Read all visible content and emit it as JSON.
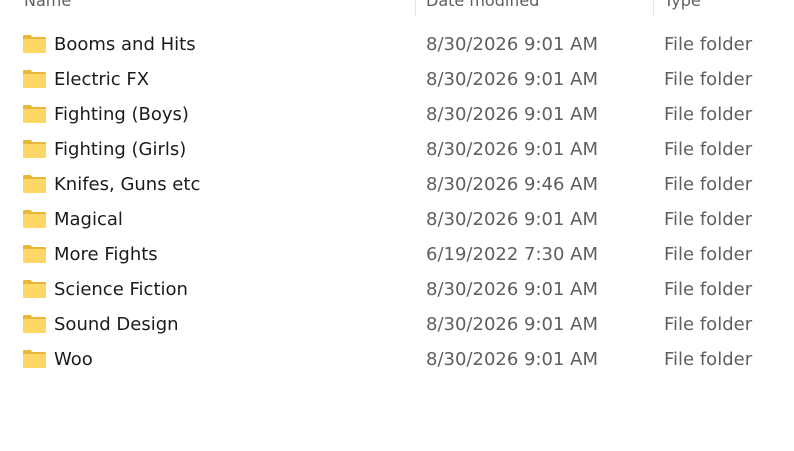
{
  "header": {
    "name_label": "Name",
    "date_label": "Date modified",
    "type_label": "Type"
  },
  "files": [
    {
      "name": "Booms and Hits",
      "date": "8/30/2026 9:01 AM",
      "type": "File folder",
      "icon": "folder-icon"
    },
    {
      "name": "Electric FX",
      "date": "8/30/2026 9:01 AM",
      "type": "File folder",
      "icon": "folder-icon"
    },
    {
      "name": "Fighting (Boys)",
      "date": "8/30/2026 9:01 AM",
      "type": "File folder",
      "icon": "folder-icon"
    },
    {
      "name": "Fighting (Girls)",
      "date": "8/30/2026 9:01 AM",
      "type": "File folder",
      "icon": "folder-icon"
    },
    {
      "name": "Knifes, Guns etc",
      "date": "8/30/2026 9:46 AM",
      "type": "File folder",
      "icon": "folder-icon"
    },
    {
      "name": "Magical",
      "date": "8/30/2026 9:01 AM",
      "type": "File folder",
      "icon": "folder-icon"
    },
    {
      "name": "More Fights",
      "date": "6/19/2022 7:30 AM",
      "type": "File folder",
      "icon": "folder-icon"
    },
    {
      "name": "Science Fiction",
      "date": "8/30/2026 9:01 AM",
      "type": "File folder",
      "icon": "folder-icon"
    },
    {
      "name": "Sound Design",
      "date": "8/30/2026 9:01 AM",
      "type": "File folder",
      "icon": "folder-icon"
    },
    {
      "name": "Woo",
      "date": "8/30/2026 9:01 AM",
      "type": "File folder",
      "icon": "folder-icon"
    }
  ],
  "colors": {
    "folder_back": "#e8b73a",
    "folder_front": "#ffd766",
    "text_primary": "#1b1b1b",
    "text_secondary": "#5f5f5f"
  }
}
